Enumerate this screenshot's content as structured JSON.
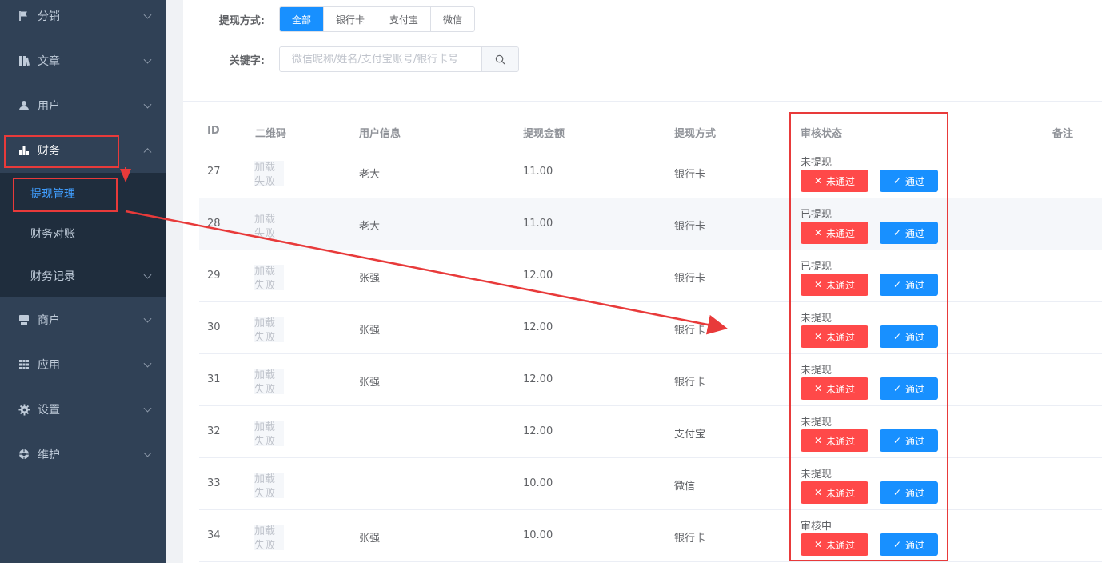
{
  "sidebar": {
    "items": [
      {
        "label": "分销",
        "icon": "flag-icon"
      },
      {
        "label": "文章",
        "icon": "book-icon"
      },
      {
        "label": "用户",
        "icon": "user-icon"
      },
      {
        "label": "财务",
        "icon": "bar-chart-icon"
      },
      {
        "label": "商户",
        "icon": "shop-icon"
      },
      {
        "label": "应用",
        "icon": "grid-icon"
      },
      {
        "label": "设置",
        "icon": "gear-icon"
      },
      {
        "label": "维护",
        "icon": "wrench-icon"
      }
    ],
    "sub_items": [
      {
        "label": "提现管理"
      },
      {
        "label": "财务对账"
      },
      {
        "label": "财务记录"
      }
    ]
  },
  "filter": {
    "method_label": "提现方式:",
    "methods": [
      "全部",
      "银行卡",
      "支付宝",
      "微信"
    ],
    "keyword_label": "关键字:",
    "keyword_placeholder": "微信昵称/姓名/支付宝账号/银行卡号"
  },
  "table": {
    "headers": [
      "ID",
      "二维码",
      "用户信息",
      "提现金额",
      "提现方式",
      "审核状态",
      "备注"
    ],
    "qr_placeholder": "加载失败",
    "reject_label": "未通过",
    "pass_label": "通过",
    "rows": [
      {
        "id": "27",
        "user": "老大",
        "amount": "11.00",
        "method": "银行卡",
        "status": "未提现"
      },
      {
        "id": "28",
        "user": "老大",
        "amount": "11.00",
        "method": "银行卡",
        "status": "已提现"
      },
      {
        "id": "29",
        "user": "张强",
        "amount": "12.00",
        "method": "银行卡",
        "status": "已提现"
      },
      {
        "id": "30",
        "user": "张强",
        "amount": "12.00",
        "method": "银行卡",
        "status": "未提现"
      },
      {
        "id": "31",
        "user": "张强",
        "amount": "12.00",
        "method": "银行卡",
        "status": "未提现"
      },
      {
        "id": "32",
        "user": "",
        "amount": "12.00",
        "method": "支付宝",
        "status": "未提现"
      },
      {
        "id": "33",
        "user": "",
        "amount": "10.00",
        "method": "微信",
        "status": "未提现"
      },
      {
        "id": "34",
        "user": "张强",
        "amount": "10.00",
        "method": "银行卡",
        "status": "审核中"
      }
    ]
  },
  "colors": {
    "sidebar_bg": "#304156",
    "submenu_bg": "#1f2d3d",
    "primary": "#1890ff",
    "danger": "#ff4949",
    "annotation": "#e83a3a"
  }
}
